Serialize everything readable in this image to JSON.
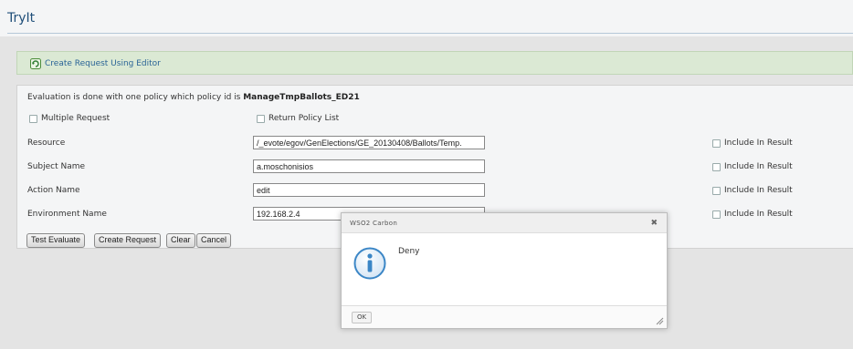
{
  "header": {
    "title": "TryIt"
  },
  "editor": {
    "link_label": "Create Request Using Editor"
  },
  "evaluation": {
    "text_prefix": "Evaluation is done with one policy which policy id is ",
    "policy_id": "ManageTmpBallots_ED21"
  },
  "options": {
    "multiple_request_label": "Multiple Request",
    "return_policy_list_label": "Return Policy List"
  },
  "fields": [
    {
      "label": "Resource",
      "value": "/_evote/egov/GenElections/GE_20130408/Ballots/Temp.",
      "include_label": "Include In Result"
    },
    {
      "label": "Subject Name",
      "value": "a.moschonisios",
      "include_label": "Include In Result"
    },
    {
      "label": "Action Name",
      "value": "edit",
      "include_label": "Include In Result"
    },
    {
      "label": "Environment Name",
      "value": "192.168.2.4",
      "include_label": "Include In Result"
    }
  ],
  "buttons": {
    "test_evaluate": "Test Evaluate",
    "create_request": "Create Request",
    "clear": "Clear",
    "cancel": "Cancel"
  },
  "dialog": {
    "title": "WSO2 Carbon",
    "message": "Deny",
    "ok_label": "OK",
    "close_glyph": "✖"
  },
  "colors": {
    "title": "#1f4e79",
    "editor_bar": "#dbe9d4",
    "link": "#2a6496",
    "info_icon": "#3b86c6"
  }
}
